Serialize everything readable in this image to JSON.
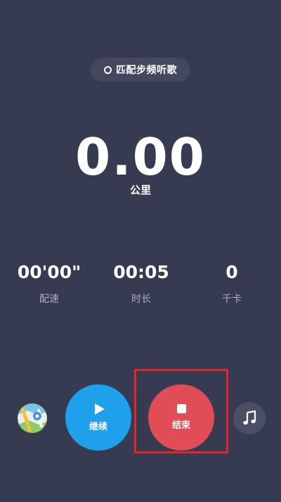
{
  "header": {
    "match_cadence_label": "匹配步频听歌"
  },
  "distance": {
    "value": "0.00",
    "unit": "公里"
  },
  "stats": {
    "pace": {
      "value": "00'00\"",
      "label": "配速"
    },
    "duration": {
      "value": "00:05",
      "label": "时长"
    },
    "calories": {
      "value": "0",
      "label": "千卡"
    }
  },
  "controls": {
    "continue_label": "继续",
    "end_label": "结束"
  },
  "colors": {
    "background": "#363b52",
    "continue": "#1ea0ea",
    "end": "#e04d57",
    "highlight": "#e0262a"
  },
  "icons": {
    "map": "map-icon",
    "music": "music-note-icon",
    "play": "play-icon",
    "stop": "stop-icon",
    "radio": "radio-circle-icon"
  }
}
